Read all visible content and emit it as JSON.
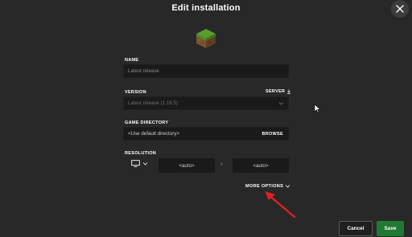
{
  "window": {
    "title": "Edit installation"
  },
  "icons": {
    "close": "close-icon",
    "block": "grass-block-icon",
    "monitor": "monitor-icon",
    "chevron": "chevron-down-icon",
    "download": "download-icon",
    "pointer": "mouse-cursor-icon",
    "annotation": "red-arrow-annotation"
  },
  "form": {
    "name": {
      "label": "NAME",
      "placeholder": "Latest release"
    },
    "version": {
      "label": "VERSION",
      "value": "Latest release (1.16.5)",
      "server_label": "SERVER"
    },
    "game_directory": {
      "label": "GAME DIRECTORY",
      "value": "<Use default directory>",
      "browse_label": "BROWSE"
    },
    "resolution": {
      "label": "RESOLUTION",
      "width": "<auto>",
      "separator": "×",
      "height": "<auto>"
    }
  },
  "more_options": {
    "label": "MORE OPTIONS"
  },
  "footer": {
    "cancel_label": "Cancel",
    "save_label": "Save"
  },
  "colors": {
    "background": "#282828",
    "field": "#1a1a1a",
    "accent_save": "#1f7a34",
    "annotation": "#e02020"
  }
}
